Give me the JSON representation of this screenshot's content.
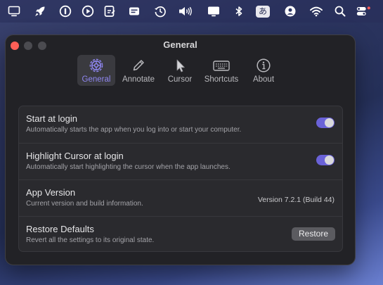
{
  "menubar": {
    "icons": [
      "display-icon",
      "rocket-icon",
      "onepassword-icon",
      "play-circle-icon",
      "notes-icon",
      "controlcenter-app-icon",
      "time-machine-icon",
      "volume-icon",
      "screen-mirroring-icon",
      "bluetooth-icon",
      "input-method-icon",
      "user-icon",
      "wifi-icon",
      "spotlight-icon",
      "control-center-icon"
    ],
    "input_method": "あ"
  },
  "window": {
    "title": "General",
    "tabs": [
      {
        "label": "General",
        "icon": "gear-icon",
        "active": true
      },
      {
        "label": "Annotate",
        "icon": "pencil-icon",
        "active": false
      },
      {
        "label": "Cursor",
        "icon": "cursor-icon",
        "active": false
      },
      {
        "label": "Shortcuts",
        "icon": "keyboard-icon",
        "active": false
      },
      {
        "label": "About",
        "icon": "info-icon",
        "active": false
      }
    ],
    "settings": {
      "start_at_login": {
        "title": "Start at login",
        "description": "Automatically starts the app when you log into or start your computer.",
        "enabled": true
      },
      "highlight_cursor": {
        "title": "Highlight Cursor at login",
        "description": "Automatically start highlighting the cursor when the app launches.",
        "enabled": true
      },
      "app_version": {
        "title": "App Version",
        "description": "Current version and build information.",
        "value": "Version 7.2.1 (Build 44)"
      },
      "restore_defaults": {
        "title": "Restore Defaults",
        "description": "Revert all the settings to its original state.",
        "button_label": "Restore"
      }
    }
  },
  "colors": {
    "accent": "#8f86f0",
    "toggle_on": "#6a62d8",
    "close_light": "#fe5f57"
  }
}
